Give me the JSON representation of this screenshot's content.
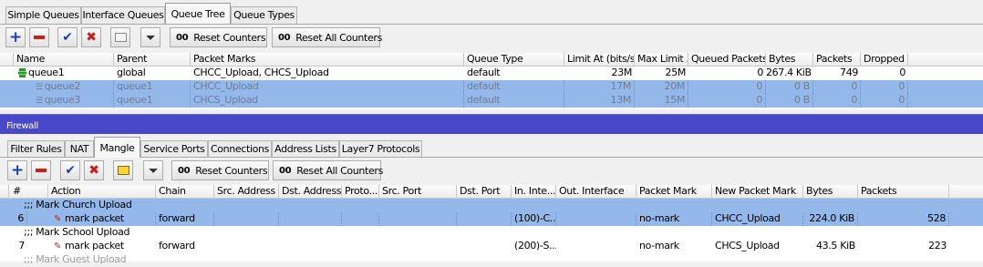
{
  "queue_window": {
    "tabs": [
      "Simple Queues",
      "Interface Queues",
      "Queue Tree",
      "Queue Types"
    ],
    "active_tab": "Queue Tree",
    "toolbar": {
      "reset_counters": "Reset Counters",
      "reset_all_counters": "Reset All Counters",
      "oo": "00"
    },
    "columns": [
      "Name",
      "Parent",
      "Packet Marks",
      "Queue Type",
      "Limit At (bits/s)",
      "Max Limit ...",
      "Queued Packets",
      "Bytes",
      "Packets",
      "Dropped"
    ],
    "rows": [
      {
        "name": "queue1",
        "parent": "global",
        "packet_marks": "CHCC_Upload, CHCS_Upload",
        "queue_type": "default",
        "limit_at": "23M",
        "max_limit": "25M",
        "queued": "0",
        "bytes": "267.4 KiB",
        "packets": "749",
        "dropped": "0",
        "selected": false,
        "disabled": false
      },
      {
        "name": "queue2",
        "parent": "queue1",
        "packet_marks": "CHCC_Upload",
        "queue_type": "default",
        "limit_at": "17M",
        "max_limit": "20M",
        "queued": "0",
        "bytes": "0 B",
        "packets": "0",
        "dropped": "0",
        "selected": true,
        "disabled": true
      },
      {
        "name": "queue3",
        "parent": "queue1",
        "packet_marks": "CHCS_Upload",
        "queue_type": "default",
        "limit_at": "13M",
        "max_limit": "15M",
        "queued": "0",
        "bytes": "0 B",
        "packets": "0",
        "dropped": "0",
        "selected": true,
        "disabled": true
      }
    ]
  },
  "firewall_window": {
    "title": "Firewall",
    "tabs": [
      "Filter Rules",
      "NAT",
      "Mangle",
      "Service Ports",
      "Connections",
      "Address Lists",
      "Layer7 Protocols"
    ],
    "active_tab": "Mangle",
    "toolbar": {
      "reset_counters": "Reset Counters",
      "reset_all_counters": "Reset All Counters",
      "oo": "00"
    },
    "columns": [
      "#",
      "Action",
      "Chain",
      "Src. Address",
      "Dst. Address",
      "Proto...",
      "Src. Port",
      "Dst. Port",
      "In. Inte...",
      "Out. Interface",
      "Packet Mark",
      "New Packet Mark",
      "Bytes",
      "Packets"
    ],
    "comments": [
      ";;; Mark Church Upload",
      ";;; Mark School Upload",
      ";;; Mark Guest Upload"
    ],
    "rules": [
      {
        "num": "6",
        "action": "mark packet",
        "chain": "forward",
        "in_interface": "(100)-C...",
        "packet_mark": "no-mark",
        "new_packet_mark": "CHCC_Upload",
        "bytes": "224.0 KiB",
        "packets": "528",
        "selected": true
      },
      {
        "num": "7",
        "action": "mark packet",
        "chain": "forward",
        "in_interface": "(200)-S...",
        "packet_mark": "no-mark",
        "new_packet_mark": "CHCS_Upload",
        "bytes": "43.5 KiB",
        "packets": "223",
        "selected": false
      }
    ]
  },
  "colors": {
    "firewall_bar": "#4848c9",
    "selection": "#93b8e9",
    "add": "#1f3fb8",
    "remove": "#c81e1e"
  },
  "icons": [
    "add-icon",
    "remove-icon",
    "enable-icon",
    "disable-icon",
    "comment-icon",
    "filter-icon",
    "queue-icon",
    "edit-icon"
  ]
}
